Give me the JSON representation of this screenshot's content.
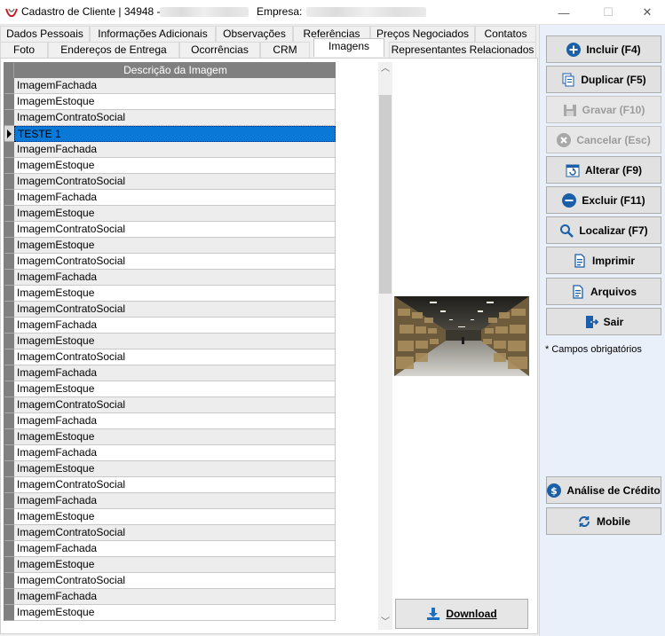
{
  "window": {
    "title": "Cadastro de Cliente | 34948 -",
    "company_label": "Empresa:",
    "minimize": "—",
    "maximize": "☐",
    "close": "✕"
  },
  "tabs_row1": [
    "Dados Pessoais",
    "Informações Adicionais",
    "Observações",
    "Referências",
    "Preços Negociados",
    "Contatos"
  ],
  "tabs_row2": [
    "Foto",
    "Endereços de Entrega",
    "Ocorrências",
    "CRM",
    "Imagens",
    "Representantes Relacionados"
  ],
  "active_tab": "Imagens",
  "grid": {
    "header": "Descrição da Imagem",
    "rows": [
      "ImagemFachada",
      "ImagemEstoque",
      "ImagemContratoSocial",
      "TESTE 1",
      "ImagemFachada",
      "ImagemEstoque",
      "ImagemContratoSocial",
      "ImagemFachada",
      "ImagemEstoque",
      "ImagemContratoSocial",
      "ImagemEstoque",
      "ImagemContratoSocial",
      "ImagemFachada",
      "ImagemEstoque",
      "ImagemContratoSocial",
      "ImagemFachada",
      "ImagemEstoque",
      "ImagemContratoSocial",
      "ImagemFachada",
      "ImagemEstoque",
      "ImagemContratoSocial",
      "ImagemFachada",
      "ImagemEstoque",
      "ImagemFachada",
      "ImagemEstoque",
      "ImagemContratoSocial",
      "ImagemFachada",
      "ImagemEstoque",
      "ImagemContratoSocial",
      "ImagemFachada",
      "ImagemEstoque",
      "ImagemContratoSocial",
      "ImagemFachada",
      "ImagemEstoque"
    ],
    "selected_index": 3
  },
  "preview": {
    "download_label": "Download"
  },
  "actions": {
    "incluir": "Incluir (F4)",
    "duplicar": "Duplicar (F5)",
    "gravar": "Gravar (F10)",
    "cancelar": "Cancelar (Esc)",
    "alterar": "Alterar (F9)",
    "excluir": "Excluir (F11)",
    "localizar": "Localizar (F7)",
    "imprimir": "Imprimir",
    "arquivos": "Arquivos",
    "sair": "Sair",
    "analise_credito": "Análise de Crédito",
    "mobile": "Mobile"
  },
  "required_note": "* Campos obrigatórios",
  "colors": {
    "accent": "#1b5fa8",
    "selection": "#0a78d7",
    "sidebar_bg": "#eaf0fa"
  }
}
